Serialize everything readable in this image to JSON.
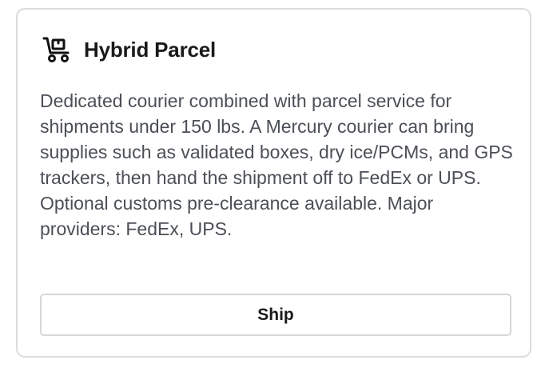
{
  "card": {
    "icon": "hand-truck-icon",
    "title": "Hybrid Parcel",
    "description": "Dedicated courier combined with parcel service for shipments under 150 lbs. A Mercury courier can bring supplies such as validated boxes, dry ice/PCMs, and GPS trackers, then hand the shipment off to FedEx or UPS. Optional customs pre-clearance available. Major providers: FedEx, UPS.",
    "button_label": "Ship"
  },
  "colors": {
    "border": "#dcdcdc",
    "title": "#1a1a1a",
    "body_text": "#4b4f56",
    "button_border": "#d7d7d7"
  }
}
